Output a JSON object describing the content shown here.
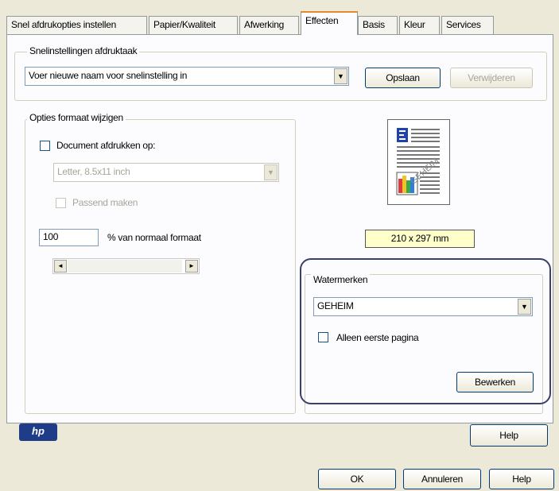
{
  "tabs": [
    {
      "label": "Snel afdrukopties instellen"
    },
    {
      "label": "Papier/Kwaliteit"
    },
    {
      "label": "Afwerking"
    },
    {
      "label": "Effecten"
    },
    {
      "label": "Basis"
    },
    {
      "label": "Kleur"
    },
    {
      "label": "Services"
    }
  ],
  "quick_settings": {
    "group_title": "Snelinstellingen afdruktaak",
    "combo_value": "Voer nieuwe naam voor snelinstelling in",
    "save_label": "Opslaan",
    "delete_label": "Verwijderen"
  },
  "resize": {
    "group_title": "Opties formaat wijzigen",
    "print_on_label": "Document afdrukken op:",
    "paper_value": "Letter, 8.5x11 inch",
    "fit_label": "Passend maken",
    "percent_value": "100",
    "percent_label": "% van normaal formaat"
  },
  "preview": {
    "size_text": "210 x 297 mm"
  },
  "watermarks": {
    "group_title": "Watermerken",
    "combo_value": "GEHEIM",
    "first_page_label": "Alleen eerste pagina",
    "edit_label": "Bewerken"
  },
  "footer": {
    "logo_text": "hp",
    "help_label": "Help",
    "ok_label": "OK",
    "cancel_label": "Annuleren",
    "help2_label": "Help"
  }
}
